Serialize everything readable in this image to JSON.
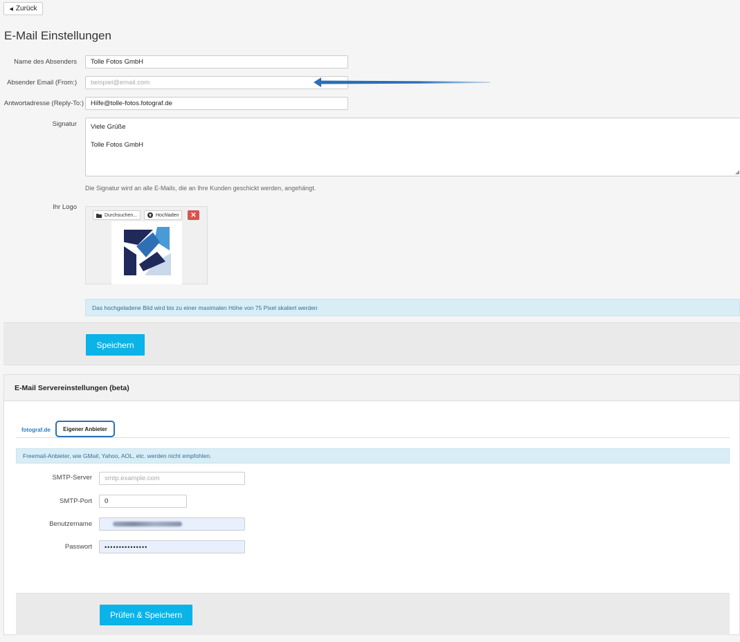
{
  "nav": {
    "back_label": "Zurück"
  },
  "page_title": "E-Mail Einstellungen",
  "form": {
    "sender_name": {
      "label": "Name des Absenders",
      "value": "Tolle Fotos GmbH"
    },
    "sender_email": {
      "label": "Absender Email (From:)",
      "placeholder": "beispiel@email.com"
    },
    "reply_to": {
      "label": "Antwortadresse (Reply-To:)",
      "value": "Hilfe@tolle-fotos.fotograf.de"
    },
    "signature": {
      "label": "Signatur",
      "lines": [
        "Viele Grüße",
        "Tolle Fotos GmbH"
      ],
      "hint": "Die Signatur wird an alle E-Mails, die an Ihre Kunden geschickt werden, angehängt."
    },
    "logo": {
      "label": "Ihr Logo",
      "browse_label": "Durchsuchen...",
      "upload_label": "Hochladen",
      "delete_symbol": "✕",
      "info": "Das hochgeladene Bild wird bis zu einer maximalen Höhe von 75 Pixel skaliert werden"
    },
    "save_label": "Speichern"
  },
  "server_panel": {
    "title": "E-Mail Servereinstellungen (beta)",
    "tabs": [
      {
        "label": "fotograf.de",
        "active": false
      },
      {
        "label": "Eigener Anbieter",
        "active": true
      }
    ],
    "info": "Freemail-Anbieter, wie GMail, Yahoo, AOL, etc. werden nicht empfohlen.",
    "smtp_server": {
      "label": "SMTP-Server",
      "placeholder": "smtp.example.com"
    },
    "smtp_port": {
      "label": "SMTP-Port",
      "value": "0"
    },
    "username": {
      "label": "Benutzername"
    },
    "password": {
      "label": "Passwort",
      "value": "•••••••••••••••"
    },
    "save_label": "Prüfen & Speichern"
  },
  "annotations": {
    "arrow_color": "#2a6fb8",
    "highlight_color": "#2a6fb8"
  },
  "colors": {
    "primary": "#0ab3e8",
    "info_bg": "#d9edf7",
    "info_text": "#31708f",
    "danger": "#d9534f"
  },
  "icons": {
    "back": "caret-left-icon",
    "browse": "folder-icon",
    "upload": "upload-icon",
    "delete": "close-icon"
  }
}
